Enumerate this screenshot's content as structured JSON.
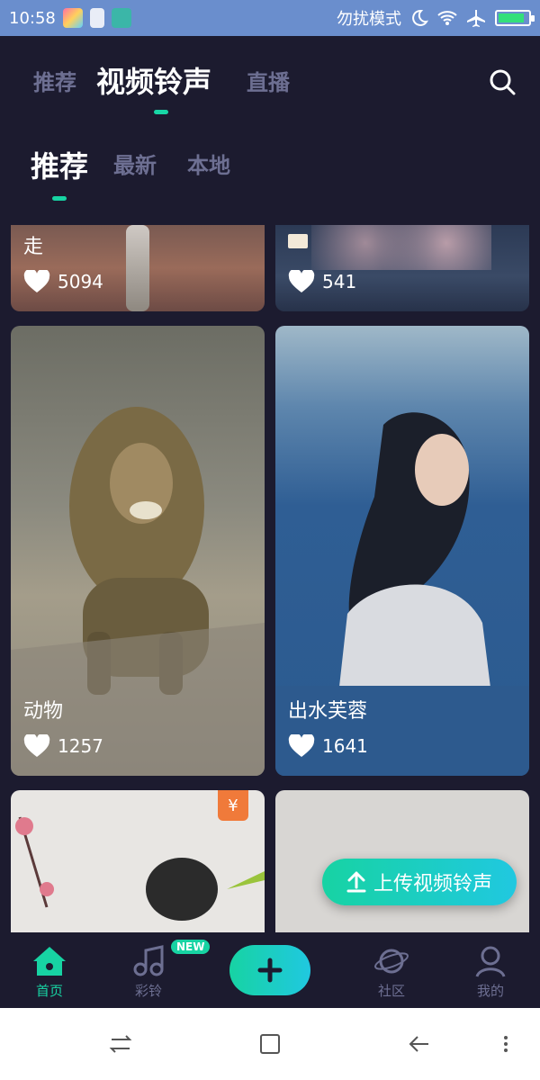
{
  "status": {
    "time": "10:58",
    "mode": "勿扰模式"
  },
  "topnav": {
    "tabs": [
      "推荐",
      "视频铃声",
      "直播"
    ]
  },
  "subnav": {
    "tabs": [
      "推荐",
      "最新",
      "本地"
    ]
  },
  "cards": [
    {
      "title": "走",
      "likes": "5094"
    },
    {
      "title": "",
      "likes": "541"
    },
    {
      "title": "动物",
      "likes": "1257"
    },
    {
      "title": "出水芙蓉",
      "likes": "1641"
    }
  ],
  "badges": {
    "yuan": "¥",
    "new": "NEW"
  },
  "upload_label": "上传视频铃声",
  "bottomnav": {
    "home": "首页",
    "ring": "彩铃",
    "community": "社区",
    "mine": "我的"
  },
  "colors": {
    "accent": "#17d3a3",
    "bg": "#1c1b2f",
    "statusbar": "#6a8ecd"
  }
}
